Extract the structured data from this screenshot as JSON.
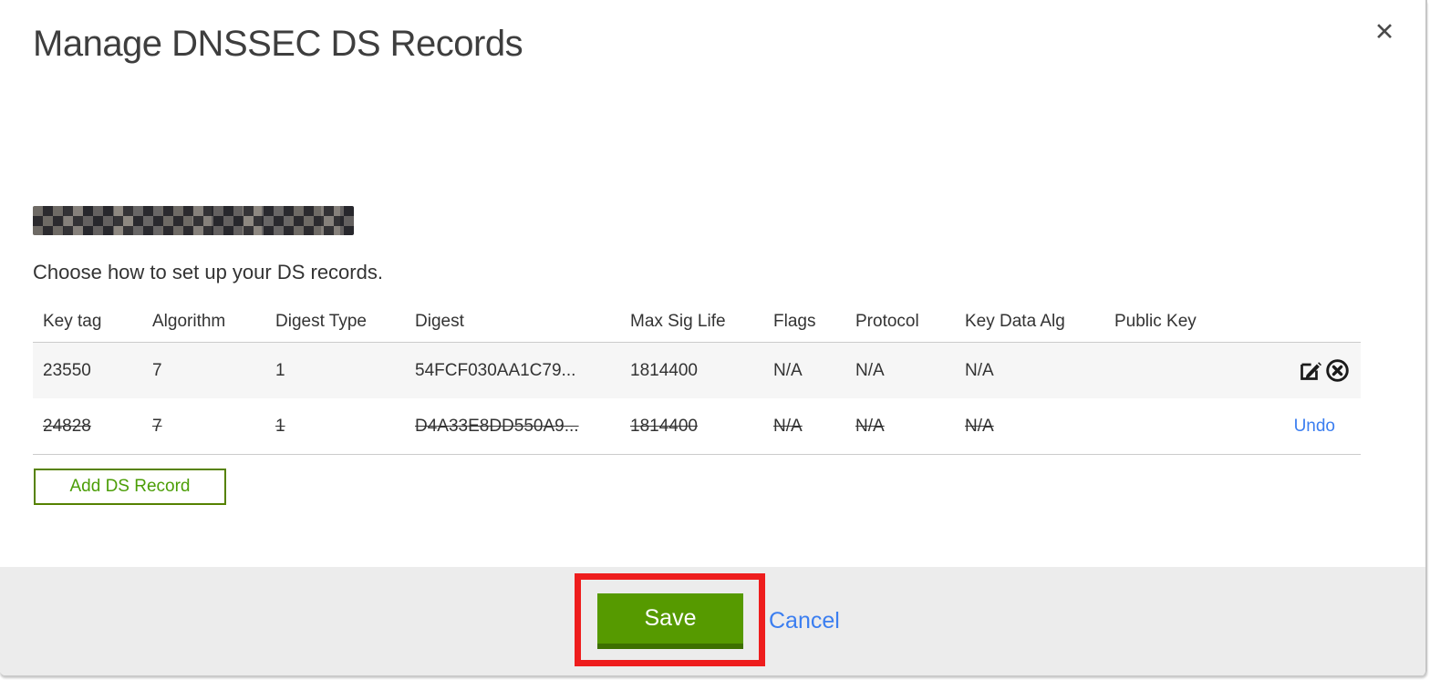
{
  "modal": {
    "title": "Manage DNSSEC DS Records",
    "close_icon": "✕",
    "domain": {
      "redacted": true
    },
    "instruction": "Choose how to set up your DS records."
  },
  "table": {
    "headers": [
      "Key tag",
      "Algorithm",
      "Digest Type",
      "Digest",
      "Max Sig Life",
      "Flags",
      "Protocol",
      "Key Data Alg",
      "Public Key"
    ],
    "rows": [
      {
        "key_tag": "23550",
        "algorithm": "7",
        "digest_type": "1",
        "digest": "54FCF030AA1C79...",
        "max_sig_life": "1814400",
        "flags": "N/A",
        "protocol": "N/A",
        "key_data_alg": "N/A",
        "public_key": "",
        "state": "normal",
        "actions": [
          "edit",
          "delete"
        ]
      },
      {
        "key_tag": "24828",
        "algorithm": "7",
        "digest_type": "1",
        "digest": "D4A33E8DD550A9...",
        "max_sig_life": "1814400",
        "flags": "N/A",
        "protocol": "N/A",
        "key_data_alg": "N/A",
        "public_key": "",
        "state": "deleted",
        "undo_label": "Undo"
      }
    ]
  },
  "buttons": {
    "add_ds_record": "Add DS Record",
    "save": "Save",
    "cancel": "Cancel"
  },
  "annotation": {
    "shape": "rectangle",
    "color": "#ee1d1d",
    "target": "save-button"
  },
  "colors": {
    "primary_green": "#569a00",
    "green_shadow": "#3d7000",
    "outline_green": "#568200",
    "link_blue": "#3b7ef0",
    "footer_gray": "#ececec",
    "row_gray": "#f6f6f6",
    "text": "#333333"
  }
}
